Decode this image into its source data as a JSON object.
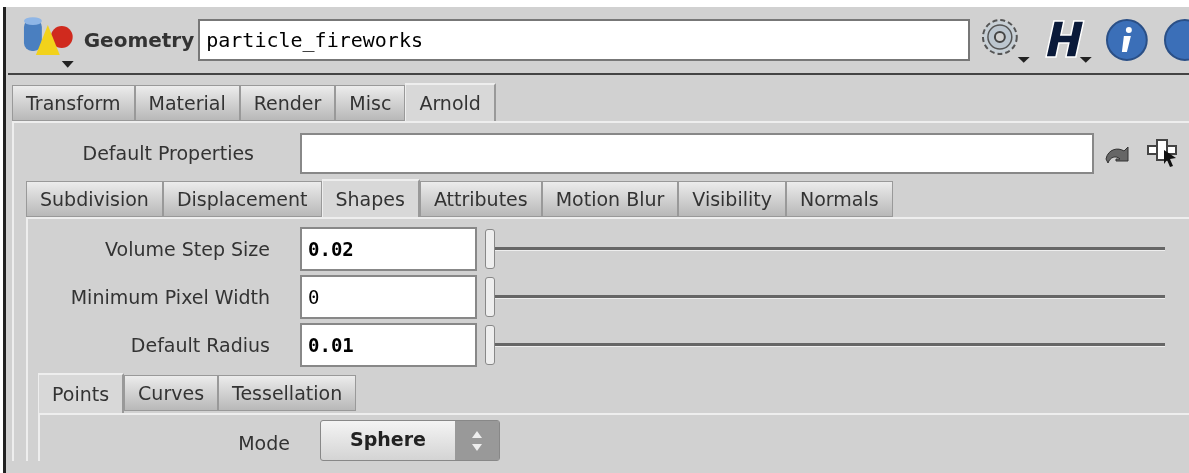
{
  "node": {
    "type_label": "Geometry",
    "name": "particle_fireworks"
  },
  "tabs": [
    {
      "label": "Transform",
      "selected": false
    },
    {
      "label": "Material",
      "selected": false
    },
    {
      "label": "Render",
      "selected": false
    },
    {
      "label": "Misc",
      "selected": false
    },
    {
      "label": "Arnold",
      "selected": true
    }
  ],
  "default_properties": {
    "label": "Default Properties"
  },
  "subtabs": [
    {
      "label": "Subdivision",
      "selected": false
    },
    {
      "label": "Displacement",
      "selected": false
    },
    {
      "label": "Shapes",
      "selected": true
    },
    {
      "label": "Attributes",
      "selected": false
    },
    {
      "label": "Motion Blur",
      "selected": false
    },
    {
      "label": "Visibility",
      "selected": false
    },
    {
      "label": "Normals",
      "selected": false
    }
  ],
  "parameters": [
    {
      "label": "Volume Step Size",
      "value": "0.02",
      "modified": true,
      "level": 0
    },
    {
      "label": "Minimum Pixel Width",
      "value": "0",
      "modified": false,
      "level": 0
    },
    {
      "label": "Default Radius",
      "value": "0.01",
      "modified": true,
      "level": 0
    }
  ],
  "shape_tabs": [
    {
      "label": "Points",
      "selected": true
    },
    {
      "label": "Curves",
      "selected": false
    },
    {
      "label": "Tessellation",
      "selected": false
    }
  ],
  "mode": {
    "label": "Mode",
    "value": "Sphere"
  }
}
